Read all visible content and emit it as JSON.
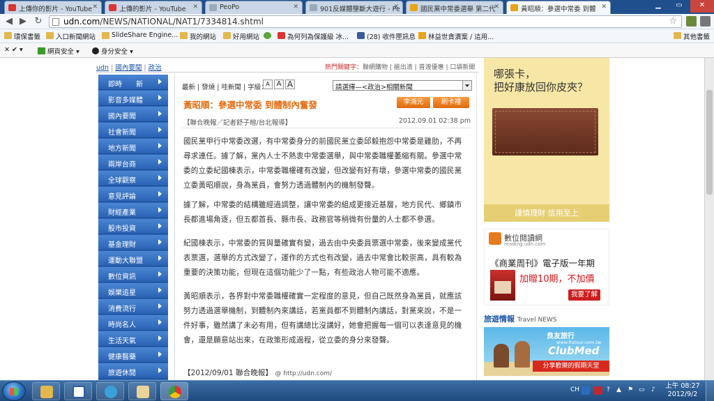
{
  "browser": {
    "tabs": [
      {
        "title": "上傳你的影片 - YouTube",
        "icon": "youtube-icon",
        "color": "#d33"
      },
      {
        "title": "上傳的影片 - YouTube",
        "icon": "youtube-icon",
        "color": "#d33"
      },
      {
        "title": "PeoPo",
        "icon": "page-icon",
        "color": "#9ab"
      },
      {
        "title": "901反媒體壟斷大遊行 - Pe",
        "icon": "page-icon",
        "color": "#9ab"
      },
      {
        "title": "國民黨中常委選舉 第二代",
        "icon": "udn-icon",
        "color": "#e8a317"
      },
      {
        "title": "黃昭順：參選中常委 到體",
        "icon": "udn-icon",
        "color": "#e8a317"
      }
    ],
    "url_host": "udn.com",
    "url_path": "/NEWS/NATIONAL/NAT1/7334814.shtml",
    "bookmarks": [
      {
        "label": "環保書籤",
        "icon": "folder-icon"
      },
      {
        "label": "入口新聞網站",
        "icon": "folder-icon"
      },
      {
        "label": "SlideShare Engine...",
        "icon": "folder-icon"
      },
      {
        "label": "我的網站",
        "icon": "folder-icon"
      },
      {
        "label": "好用網站",
        "icon": "folder-icon"
      },
      {
        "label": "",
        "icon": "refresh-leaf-icon"
      },
      {
        "label": "為何列為保護級 冰...",
        "icon": "youtube-icon"
      },
      {
        "label": "(28) 收件匣訊息",
        "icon": "facebook-icon"
      },
      {
        "label": "林益世貪瀆案 / 這用...",
        "icon": "udn-icon"
      }
    ],
    "other_bookmarks": "其他書籤",
    "security_bar": {
      "web_safety": "網頁安全",
      "identity_safety": "身分安全"
    }
  },
  "page": {
    "breadcrumb": [
      "udn",
      "國內要聞",
      "政治"
    ],
    "top_links": {
      "hot": "熱門關鍵字：",
      "links": [
        "聯網購物",
        "搶出清",
        "普渡優惠",
        "口袋新聞"
      ]
    },
    "nav": [
      "即時　　新",
      "影音多媒體",
      "國內要聞",
      "社會新聞",
      "地方新聞",
      "兩岸台商",
      "全球觀察",
      "意見評論",
      "財經產業",
      "股市投資",
      "基金理財",
      "運動大聯盟",
      "數位資訊",
      "娛樂追星",
      "消費流行",
      "時尚名人",
      "生活天氣",
      "健康醫藥",
      "旅遊休閒"
    ],
    "tools": {
      "label": "最新 | 發燒 | 哇新聞 | 字級：",
      "font_s": "A",
      "font_m": "A",
      "font_l": "A"
    },
    "select_value": "請選擇—<政治>相關新聞",
    "title": "黃昭順：參選中常委 到體制內奮發",
    "promo_buttons": [
      "李鴻元",
      "刷卡禮"
    ],
    "byline": "【聯合晚報／記者舒子榕/台北報導】",
    "date": "2012.09.01 02:38 pm",
    "paragraphs": [
      "國民黨甲行中常委改選，有中常委身分的前國民黨立委邱毅抱怨中常委是雞肋，不再尋求連任。據了解，黨內人士不熱衷中常委選舉，與中常委職權萎縮有關。參選中常委的立委紀國棟表示，中常委職權確有改變，但改變有好有壞，參選中常委的國民黨立委黃昭順說，身為黨員，會努力透過體制內的機制發聲。",
      "據了解，中常委的結構雖經過調整，讓中常委的組成更接近基層，地方民代、鄉鎮市長都進場角逐，但五都首長、縣市長、政務官等稍微有份量的人士都不參選。",
      "紀國棟表示，中常委的質與量確實有變，過去由中央委員票選中常委，後來變成黨代表票選，選舉的方式改變了，運作的方式也有改變，過去中常會比較崇高，具有較為重要的決策功能，但現在這個功能少了一點，有些政治人物可能不適應。",
      "黃昭順表示，各界對中常委職權確實一定程度的意見，但自己既然身為黨員，就應該努力透過選舉機制，到體制內來講話，若黨員都不到體制內講話，對黨來說，不是一件好事，雖然講了未必有用，但有講總比沒講好，她會把握每一個可以表達意見的機會，還是願意站出來，在政策形成過程，從立委的身分來發聲。"
    ],
    "footer_source": "【2012/09/01 聯合晚報】",
    "footer_url": "@ http://udn.com/"
  },
  "ads": {
    "wallet_ad": {
      "line1": "哪張卡，",
      "line2": "把好康放回你皮夾？",
      "tagline": "謹慎理財 信用至上"
    },
    "reading_ad": {
      "brand": "數位閱讀網",
      "brand_url": "reading.udn.com",
      "line1": "《商業周刊》電子版一年期",
      "line2": "加贈10期，不加價",
      "button": "我要了解"
    },
    "travel_title": "旅遊情報",
    "travel_sub": "Travel NEWS",
    "travel_ad": {
      "brand": "良友旅行",
      "url": "www.ftstour.com.tw",
      "club": "ClubMed",
      "caption": "分享歡樂的假期天堂"
    }
  },
  "taskbar": {
    "tray_lang": "CH",
    "clock_time": "上午 08:27",
    "clock_date": "2012/9/2"
  }
}
